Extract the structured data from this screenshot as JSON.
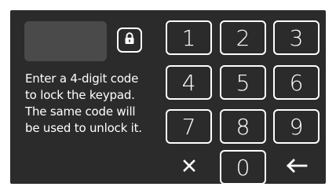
{
  "display": {
    "code_value": ""
  },
  "lock_button": {
    "icon": "lock-icon"
  },
  "instructions": {
    "lines": [
      "Enter a 4-digit code",
      "to lock the keypad.",
      "The same code will",
      "be used to unlock it."
    ]
  },
  "keypad": {
    "keys": [
      "1",
      "2",
      "3",
      "4",
      "5",
      "6",
      "7",
      "8",
      "9",
      "0"
    ],
    "clear_icon": "clear-x-icon",
    "backspace_icon": "backspace-arrow-icon"
  },
  "colors": {
    "background": "#2b2b2b",
    "display_field": "#4a4a4a",
    "foreground": "#ffffff"
  }
}
